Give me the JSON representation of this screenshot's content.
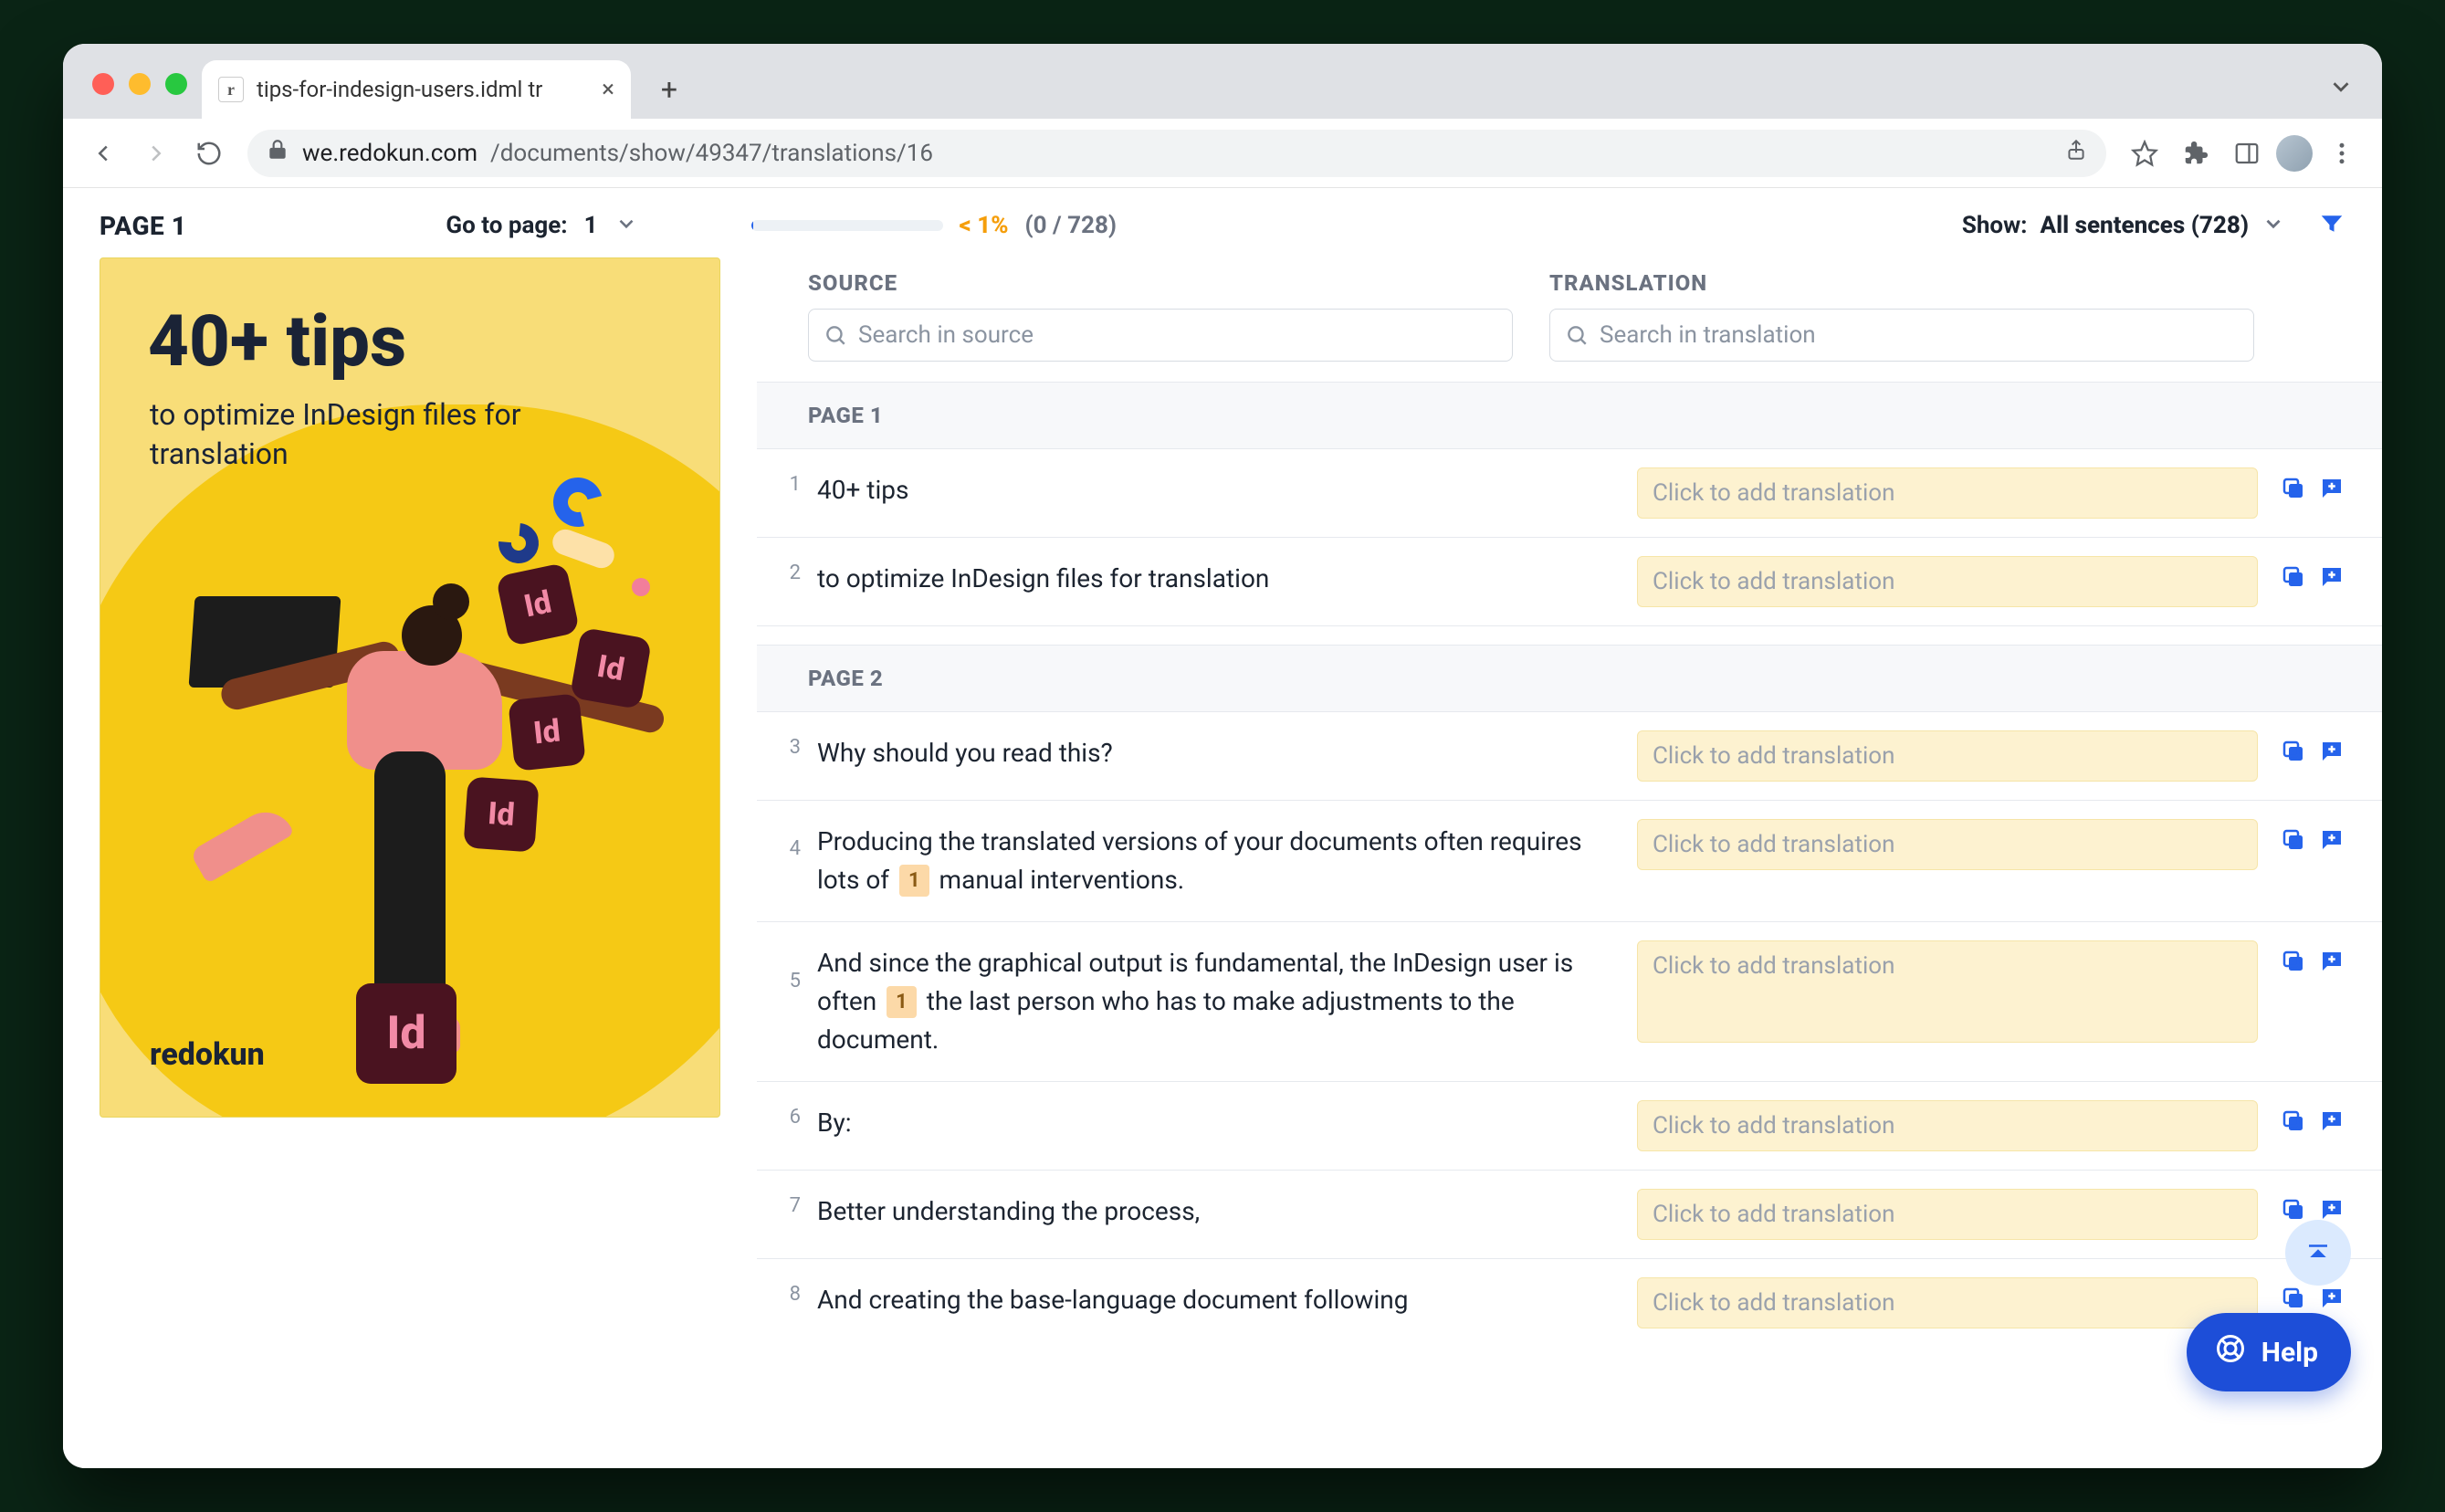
{
  "browser": {
    "tab_title": "tips-for-indesign-users.idml tr",
    "url_host": "we.redokun.com",
    "url_path": "/documents/show/49347/translations/16"
  },
  "topbar": {
    "page_label": "PAGE 1",
    "goto_label": "Go to page:",
    "goto_value": "1",
    "progress_pct": "< 1%",
    "progress_count": "(0 / 728)",
    "show_label": "Show:",
    "show_value": "All sentences (728)"
  },
  "preview": {
    "title": "40+ tips",
    "subtitle": "to optimize InDesign files for translation",
    "brand": "redokun"
  },
  "headers": {
    "source": "SOURCE",
    "translation": "TRANSLATION",
    "search_source_placeholder": "Search in source",
    "search_translation_placeholder": "Search in translation"
  },
  "translation_placeholder": "Click to add translation",
  "page_labels": {
    "p1": "PAGE 1",
    "p2": "PAGE 2"
  },
  "segments": {
    "s1": {
      "num": "1",
      "text": "40+ tips"
    },
    "s2": {
      "num": "2",
      "text": "to optimize InDesign files for translation"
    },
    "s3": {
      "num": "3",
      "text": "Why should you read this?"
    },
    "s4": {
      "num": "4",
      "before": "Producing the translated versions of your documents often requires lots of ",
      "tag": "1",
      "after": " manual interventions."
    },
    "s5": {
      "num": "5",
      "before": "And since the graphical output is fundamental, the InDesign user is often ",
      "tag": "1",
      "after": " the last person who has to make adjustments to the document."
    },
    "s6": {
      "num": "6",
      "text": "By:"
    },
    "s7": {
      "num": "7",
      "text": "Better understanding the process,"
    },
    "s8": {
      "num": "8",
      "text": "And creating the base-language document following"
    }
  },
  "help": {
    "label": "Help"
  }
}
